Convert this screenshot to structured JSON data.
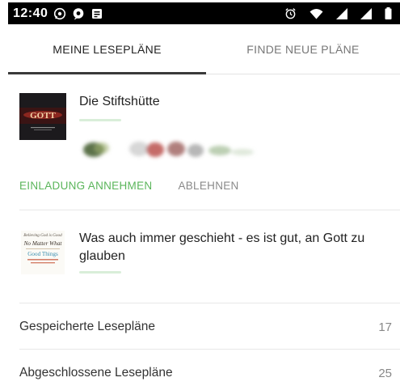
{
  "status_bar": {
    "time": "12:40",
    "left_icons": [
      "whatsapp-icon",
      "chat-bubble-icon",
      "notification-icon"
    ],
    "right_icons": [
      "alarm-icon",
      "wifi-icon",
      "signal-icon",
      "signal-icon",
      "battery-icon"
    ]
  },
  "tabs": [
    {
      "label": "MEINE LESEPLÄNE",
      "active": true
    },
    {
      "label": "FINDE NEUE PLÄNE",
      "active": false
    }
  ],
  "invite_plan": {
    "title": "Die Stiftshütte",
    "thumbnail_text": "GOTT",
    "progress_percent": 0,
    "actions": {
      "accept": "EINLADUNG ANNEHMEN",
      "decline": "ABLEHNEN"
    }
  },
  "active_plan": {
    "title": "Was auch immer geschieht - es ist gut, an Gott zu glauben",
    "progress_percent": 0,
    "cover_lines": [
      "Believing God is Good",
      "No Matter What",
      "Good Things"
    ]
  },
  "lists": [
    {
      "label": "Gespeicherte Lesepläne",
      "count": "17"
    },
    {
      "label": "Abgeschlossene Lesepläne",
      "count": "25"
    }
  ],
  "colors": {
    "accent_green": "#5ab55a",
    "status_bar": "#000000",
    "tab_underline": "#3a3a3a"
  }
}
